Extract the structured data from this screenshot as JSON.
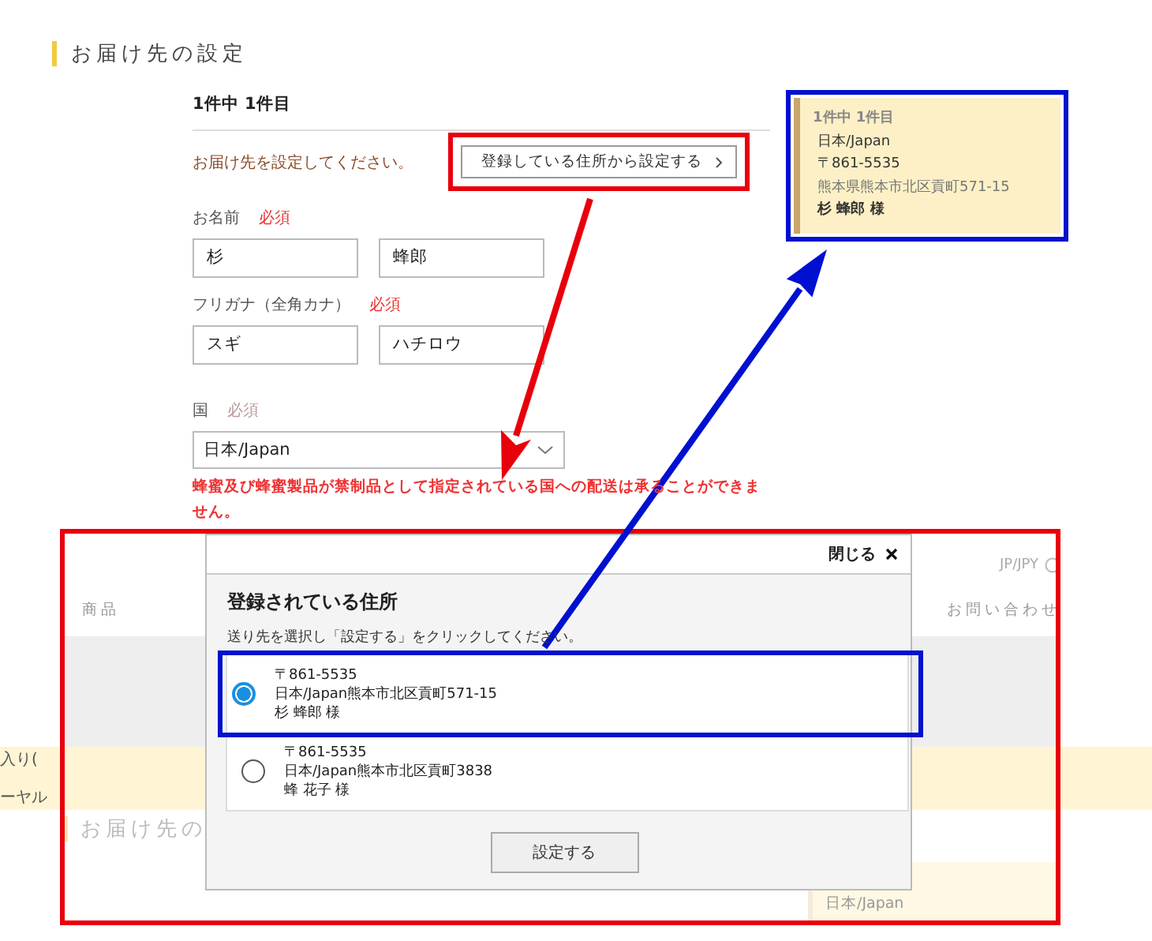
{
  "page_title": "お届け先の設定",
  "form": {
    "count": "1件中 1件目",
    "prompt": "お届け先を設定してください。",
    "address_button": "登録している住所から設定する",
    "fields": [
      {
        "label": "お名前",
        "required": "必須",
        "values": [
          "杉",
          "蜂郎"
        ]
      },
      {
        "label": "フリガナ（全角カナ）",
        "required": "必須",
        "values": [
          "スギ",
          "ハチロウ"
        ]
      }
    ],
    "country": {
      "label": "国",
      "required": "必須",
      "value": "日本/Japan"
    },
    "warning": "蜂蜜及び蜂蜜製品が禁制品として指定されている国への配送は承ることができません。"
  },
  "callout": {
    "count": "1件中 1件目",
    "country": "日本/Japan",
    "postal": "〒861-5535",
    "address": "熊本県熊本市北区貢町571-15",
    "name": "杉 蜂郎 様"
  },
  "background_page": {
    "currency": "JP/JPY",
    "nav": [
      "商品",
      "お問い合わせ"
    ],
    "banner": [
      "入り(",
      "ーヤル"
    ],
    "section_title": "お届け先の",
    "summary": "日本/Japan"
  },
  "modal": {
    "close": "閉じる",
    "title": "登録されている住所",
    "instruction": "送り先を選択し「設定する」をクリックしてください。",
    "addresses": [
      {
        "postal": "〒861-5535",
        "address": "日本/Japan熊本市北区貢町571-15",
        "name": "杉 蜂郎 様",
        "selected": true
      },
      {
        "postal": "〒861-5535",
        "address": "日本/Japan熊本市北区貢町3838",
        "name": "蜂 花子 様",
        "selected": false
      }
    ],
    "submit": "設定する"
  }
}
